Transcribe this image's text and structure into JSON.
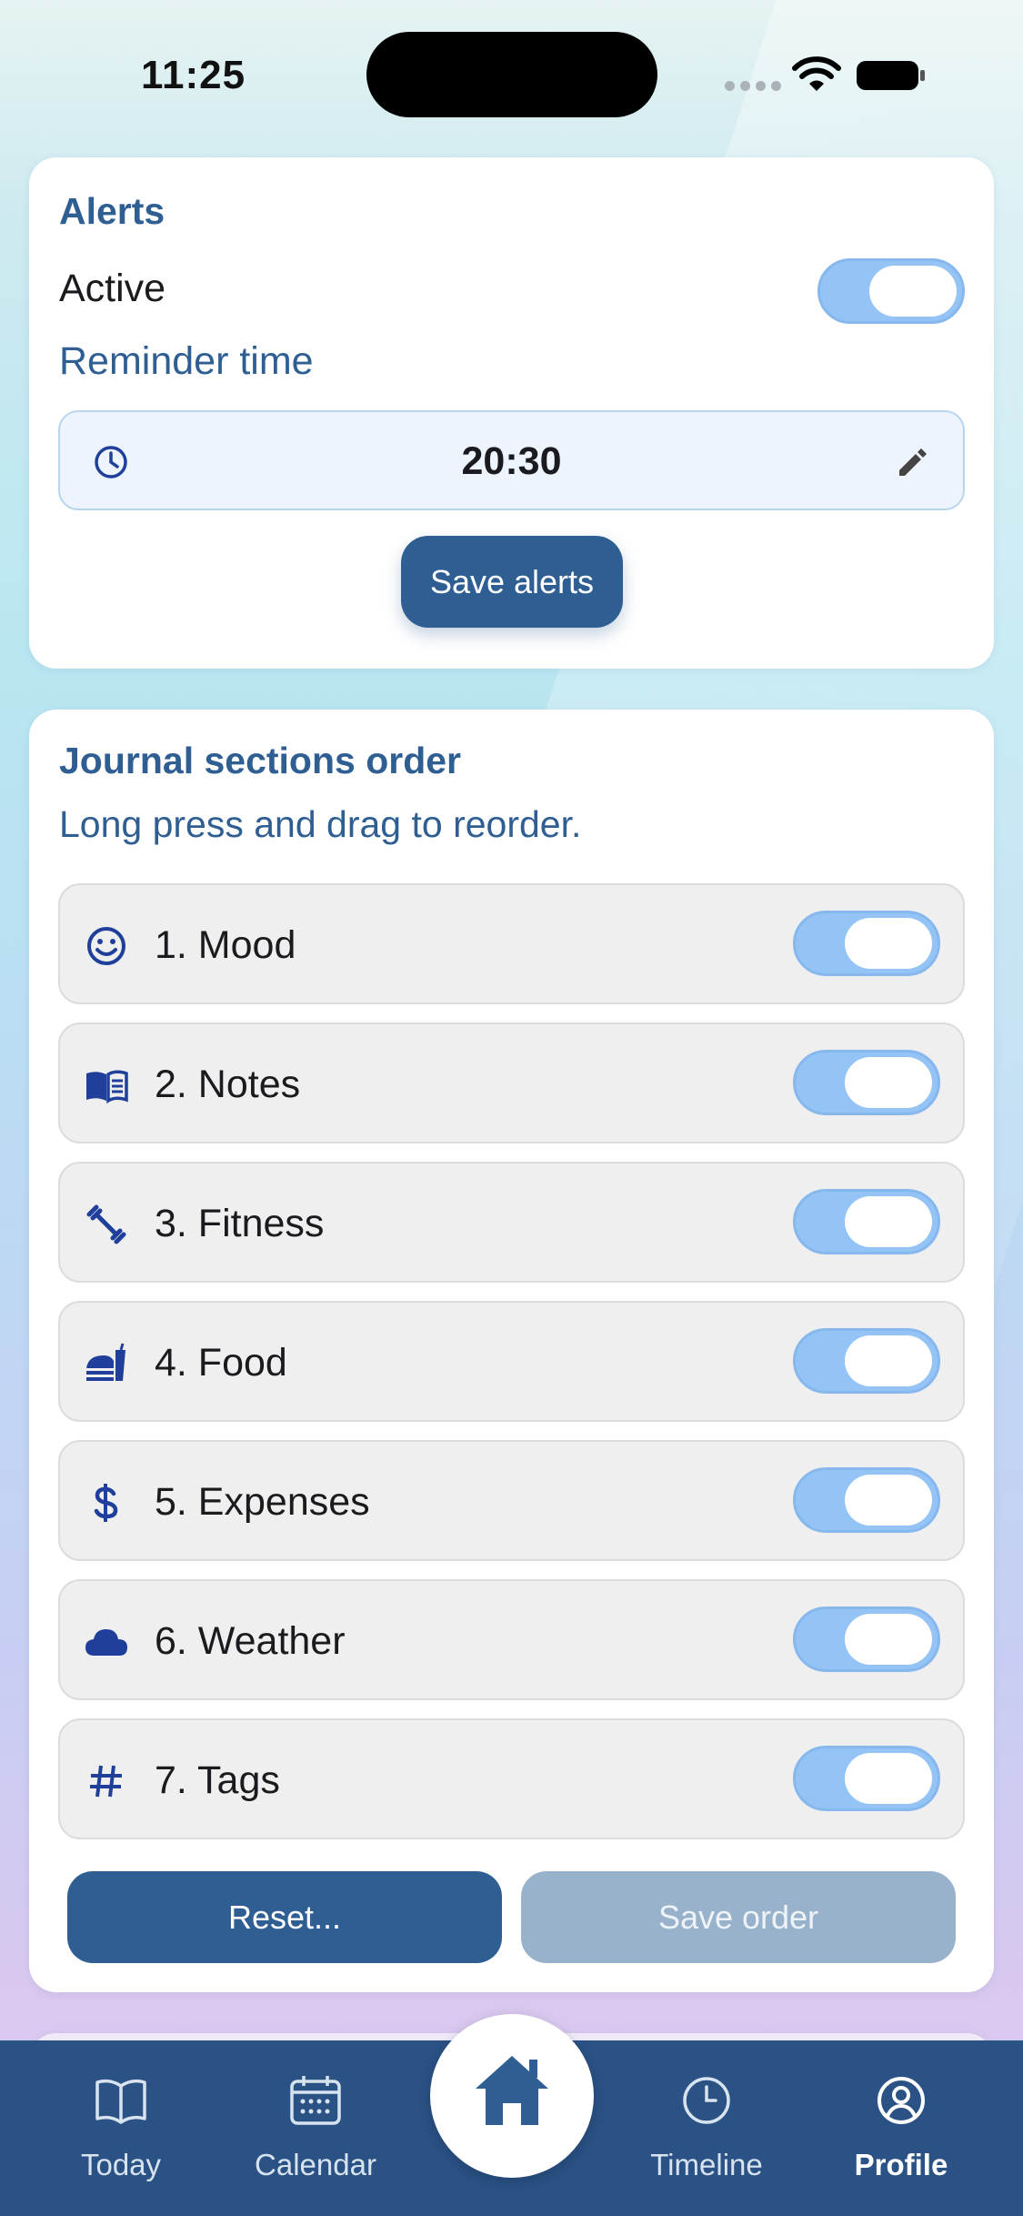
{
  "status_bar": {
    "time": "11:25"
  },
  "alerts": {
    "title": "Alerts",
    "active_label": "Active",
    "active_on": true,
    "reminder_label": "Reminder time",
    "reminder_time": "20:30",
    "save_label": "Save alerts"
  },
  "journal": {
    "title": "Journal sections order",
    "subtitle": "Long press and drag to reorder.",
    "sections": [
      {
        "label": "1. Mood",
        "icon": "smiley-icon",
        "enabled": true
      },
      {
        "label": "2. Notes",
        "icon": "book-icon",
        "enabled": true
      },
      {
        "label": "3. Fitness",
        "icon": "dumbbell-icon",
        "enabled": true
      },
      {
        "label": "4. Food",
        "icon": "food-icon",
        "enabled": true
      },
      {
        "label": "5. Expenses",
        "icon": "dollar-icon",
        "enabled": true
      },
      {
        "label": "6. Weather",
        "icon": "cloud-icon",
        "enabled": true
      },
      {
        "label": "7. Tags",
        "icon": "hashtag-icon",
        "enabled": true
      }
    ],
    "reset_label": "Reset...",
    "save_order_label": "Save order"
  },
  "nav": {
    "today": "Today",
    "calendar": "Calendar",
    "timeline": "Timeline",
    "profile": "Profile",
    "active": "profile"
  },
  "colors": {
    "primary": "#2f5e93",
    "toggle_on": "#94c4f6",
    "nav_bg": "#2a5285",
    "icon_blue": "#1f3f9a"
  }
}
